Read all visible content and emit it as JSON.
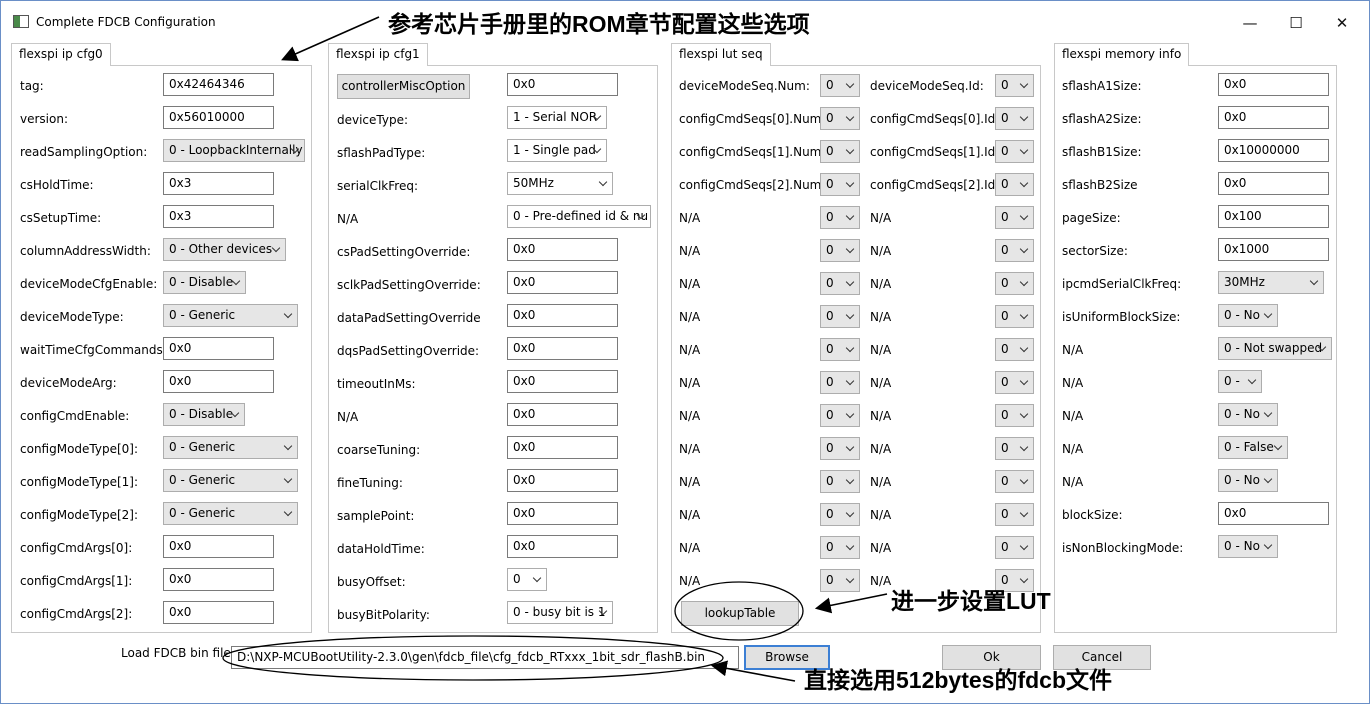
{
  "window": {
    "title": "Complete FDCB Configuration",
    "minimize": "—",
    "maximize": "☐",
    "close": "✕"
  },
  "tabs": [
    "flexspi ip cfg0",
    "flexspi ip cfg1",
    "flexspi lut seq",
    "flexspi memory info"
  ],
  "cfg0": [
    {
      "label": "tag:",
      "kind": "text",
      "value": "0x42464346"
    },
    {
      "label": "version:",
      "kind": "text",
      "value": "0x56010000"
    },
    {
      "label": "readSamplingOption:",
      "kind": "select",
      "value": "0 - LoopbackInternally"
    },
    {
      "label": "csHoldTime:",
      "kind": "text",
      "value": "0x3"
    },
    {
      "label": "csSetupTime:",
      "kind": "text",
      "value": "0x3"
    },
    {
      "label": "columnAddressWidth:",
      "kind": "select",
      "value": "0 - Other devices"
    },
    {
      "label": "deviceModeCfgEnable:",
      "kind": "select",
      "value": "0 - Disable"
    },
    {
      "label": "deviceModeType:",
      "kind": "select",
      "value": "0 - Generic"
    },
    {
      "label": "waitTimeCfgCommands:",
      "kind": "text",
      "value": "0x0"
    },
    {
      "label": "deviceModeArg:",
      "kind": "text",
      "value": "0x0"
    },
    {
      "label": "configCmdEnable:",
      "kind": "select",
      "value": "0 - Disable"
    },
    {
      "label": "configModeType[0]:",
      "kind": "select",
      "value": "0 - Generic"
    },
    {
      "label": "configModeType[1]:",
      "kind": "select",
      "value": "0 - Generic"
    },
    {
      "label": "configModeType[2]:",
      "kind": "select",
      "value": "0 - Generic"
    },
    {
      "label": "configCmdArgs[0]:",
      "kind": "text",
      "value": "0x0"
    },
    {
      "label": "configCmdArgs[1]:",
      "kind": "text",
      "value": "0x0"
    },
    {
      "label": "configCmdArgs[2]:",
      "kind": "text",
      "value": "0x0"
    }
  ],
  "cfg1": [
    {
      "label": "controllerMiscOption",
      "kind": "text",
      "value": "0x0"
    },
    {
      "label": "deviceType:",
      "kind": "select",
      "value": "1 - Serial NOR"
    },
    {
      "label": "sflashPadType:",
      "kind": "select",
      "value": "1 - Single pad"
    },
    {
      "label": "serialClkFreq:",
      "kind": "select",
      "value": "50MHz"
    },
    {
      "label": "N/A",
      "kind": "select",
      "value": "0 - Pre-defined id & nu"
    },
    {
      "label": "csPadSettingOverride:",
      "kind": "text",
      "value": "0x0"
    },
    {
      "label": "sclkPadSettingOverride:",
      "kind": "text",
      "value": "0x0"
    },
    {
      "label": "dataPadSettingOverride",
      "kind": "text",
      "value": "0x0"
    },
    {
      "label": "dqsPadSettingOverride:",
      "kind": "text",
      "value": "0x0"
    },
    {
      "label": "timeoutInMs:",
      "kind": "text",
      "value": "0x0"
    },
    {
      "label": "N/A",
      "kind": "text",
      "value": "0x0"
    },
    {
      "label": "coarseTuning:",
      "kind": "text",
      "value": "0x0"
    },
    {
      "label": "fineTuning:",
      "kind": "text",
      "value": "0x0"
    },
    {
      "label": "samplePoint:",
      "kind": "text",
      "value": "0x0"
    },
    {
      "label": "dataHoldTime:",
      "kind": "text",
      "value": "0x0"
    },
    {
      "label": "busyOffset:",
      "kind": "select",
      "value": "0"
    },
    {
      "label": "busyBitPolarity:",
      "kind": "select",
      "value": "0 - busy bit is 1"
    }
  ],
  "lut": [
    {
      "l1": "deviceModeSeq.Num:",
      "v1": "0",
      "l2": "deviceModeSeq.Id:",
      "v2": "0"
    },
    {
      "l1": "configCmdSeqs[0].Num:",
      "v1": "0",
      "l2": "configCmdSeqs[0].Id:",
      "v2": "0"
    },
    {
      "l1": "configCmdSeqs[1].Num:",
      "v1": "0",
      "l2": "configCmdSeqs[1].Id:",
      "v2": "0"
    },
    {
      "l1": "configCmdSeqs[2].Num:",
      "v1": "0",
      "l2": "configCmdSeqs[2].Id:",
      "v2": "0"
    },
    {
      "l1": "N/A",
      "v1": "0",
      "l2": "N/A",
      "v2": "0"
    },
    {
      "l1": "N/A",
      "v1": "0",
      "l2": "N/A",
      "v2": "0"
    },
    {
      "l1": "N/A",
      "v1": "0",
      "l2": "N/A",
      "v2": "0"
    },
    {
      "l1": "N/A",
      "v1": "0",
      "l2": "N/A",
      "v2": "0"
    },
    {
      "l1": "N/A",
      "v1": "0",
      "l2": "N/A",
      "v2": "0"
    },
    {
      "l1": "N/A",
      "v1": "0",
      "l2": "N/A",
      "v2": "0"
    },
    {
      "l1": "N/A",
      "v1": "0",
      "l2": "N/A",
      "v2": "0"
    },
    {
      "l1": "N/A",
      "v1": "0",
      "l2": "N/A",
      "v2": "0"
    },
    {
      "l1": "N/A",
      "v1": "0",
      "l2": "N/A",
      "v2": "0"
    },
    {
      "l1": "N/A",
      "v1": "0",
      "l2": "N/A",
      "v2": "0"
    },
    {
      "l1": "N/A",
      "v1": "0",
      "l2": "N/A",
      "v2": "0"
    },
    {
      "l1": "N/A",
      "v1": "0",
      "l2": "N/A",
      "v2": "0"
    }
  ],
  "lookup_button": "lookupTable",
  "mem": [
    {
      "label": "sflashA1Size:",
      "kind": "text",
      "value": "0x0"
    },
    {
      "label": "sflashA2Size:",
      "kind": "text",
      "value": "0x0"
    },
    {
      "label": "sflashB1Size:",
      "kind": "text",
      "value": "0x10000000"
    },
    {
      "label": "sflashB2Size",
      "kind": "text",
      "value": "0x0"
    },
    {
      "label": "pageSize:",
      "kind": "text",
      "value": "0x100"
    },
    {
      "label": "sectorSize:",
      "kind": "text",
      "value": "0x1000"
    },
    {
      "label": "ipcmdSerialClkFreq:",
      "kind": "select",
      "value": "30MHz"
    },
    {
      "label": "isUniformBlockSize:",
      "kind": "select",
      "value": "0 - No"
    },
    {
      "label": "N/A",
      "kind": "select",
      "value": "0 - Not swapped"
    },
    {
      "label": "N/A",
      "kind": "select",
      "value": "0 -"
    },
    {
      "label": "N/A",
      "kind": "select",
      "value": "0 - No"
    },
    {
      "label": "N/A",
      "kind": "select",
      "value": "0 - False"
    },
    {
      "label": "N/A",
      "kind": "select",
      "value": "0 - No"
    },
    {
      "label": "blockSize:",
      "kind": "text",
      "value": "0x0"
    },
    {
      "label": "isNonBlockingMode:",
      "kind": "select",
      "value": "0 - No"
    }
  ],
  "footer": {
    "load_label": "Load FDCB bin file:",
    "path": "D:\\NXP-MCUBootUtility-2.3.0\\gen\\fdcb_file\\cfg_fdcb_RTxxx_1bit_sdr_flashB.bin",
    "browse": "Browse",
    "ok": "Ok",
    "cancel": "Cancel"
  },
  "annotations": {
    "top": "参考芯片手册里的ROM章节配置这些选项",
    "lut": "进一步设置LUT",
    "file": "直接选用512bytes的fdcb文件"
  }
}
